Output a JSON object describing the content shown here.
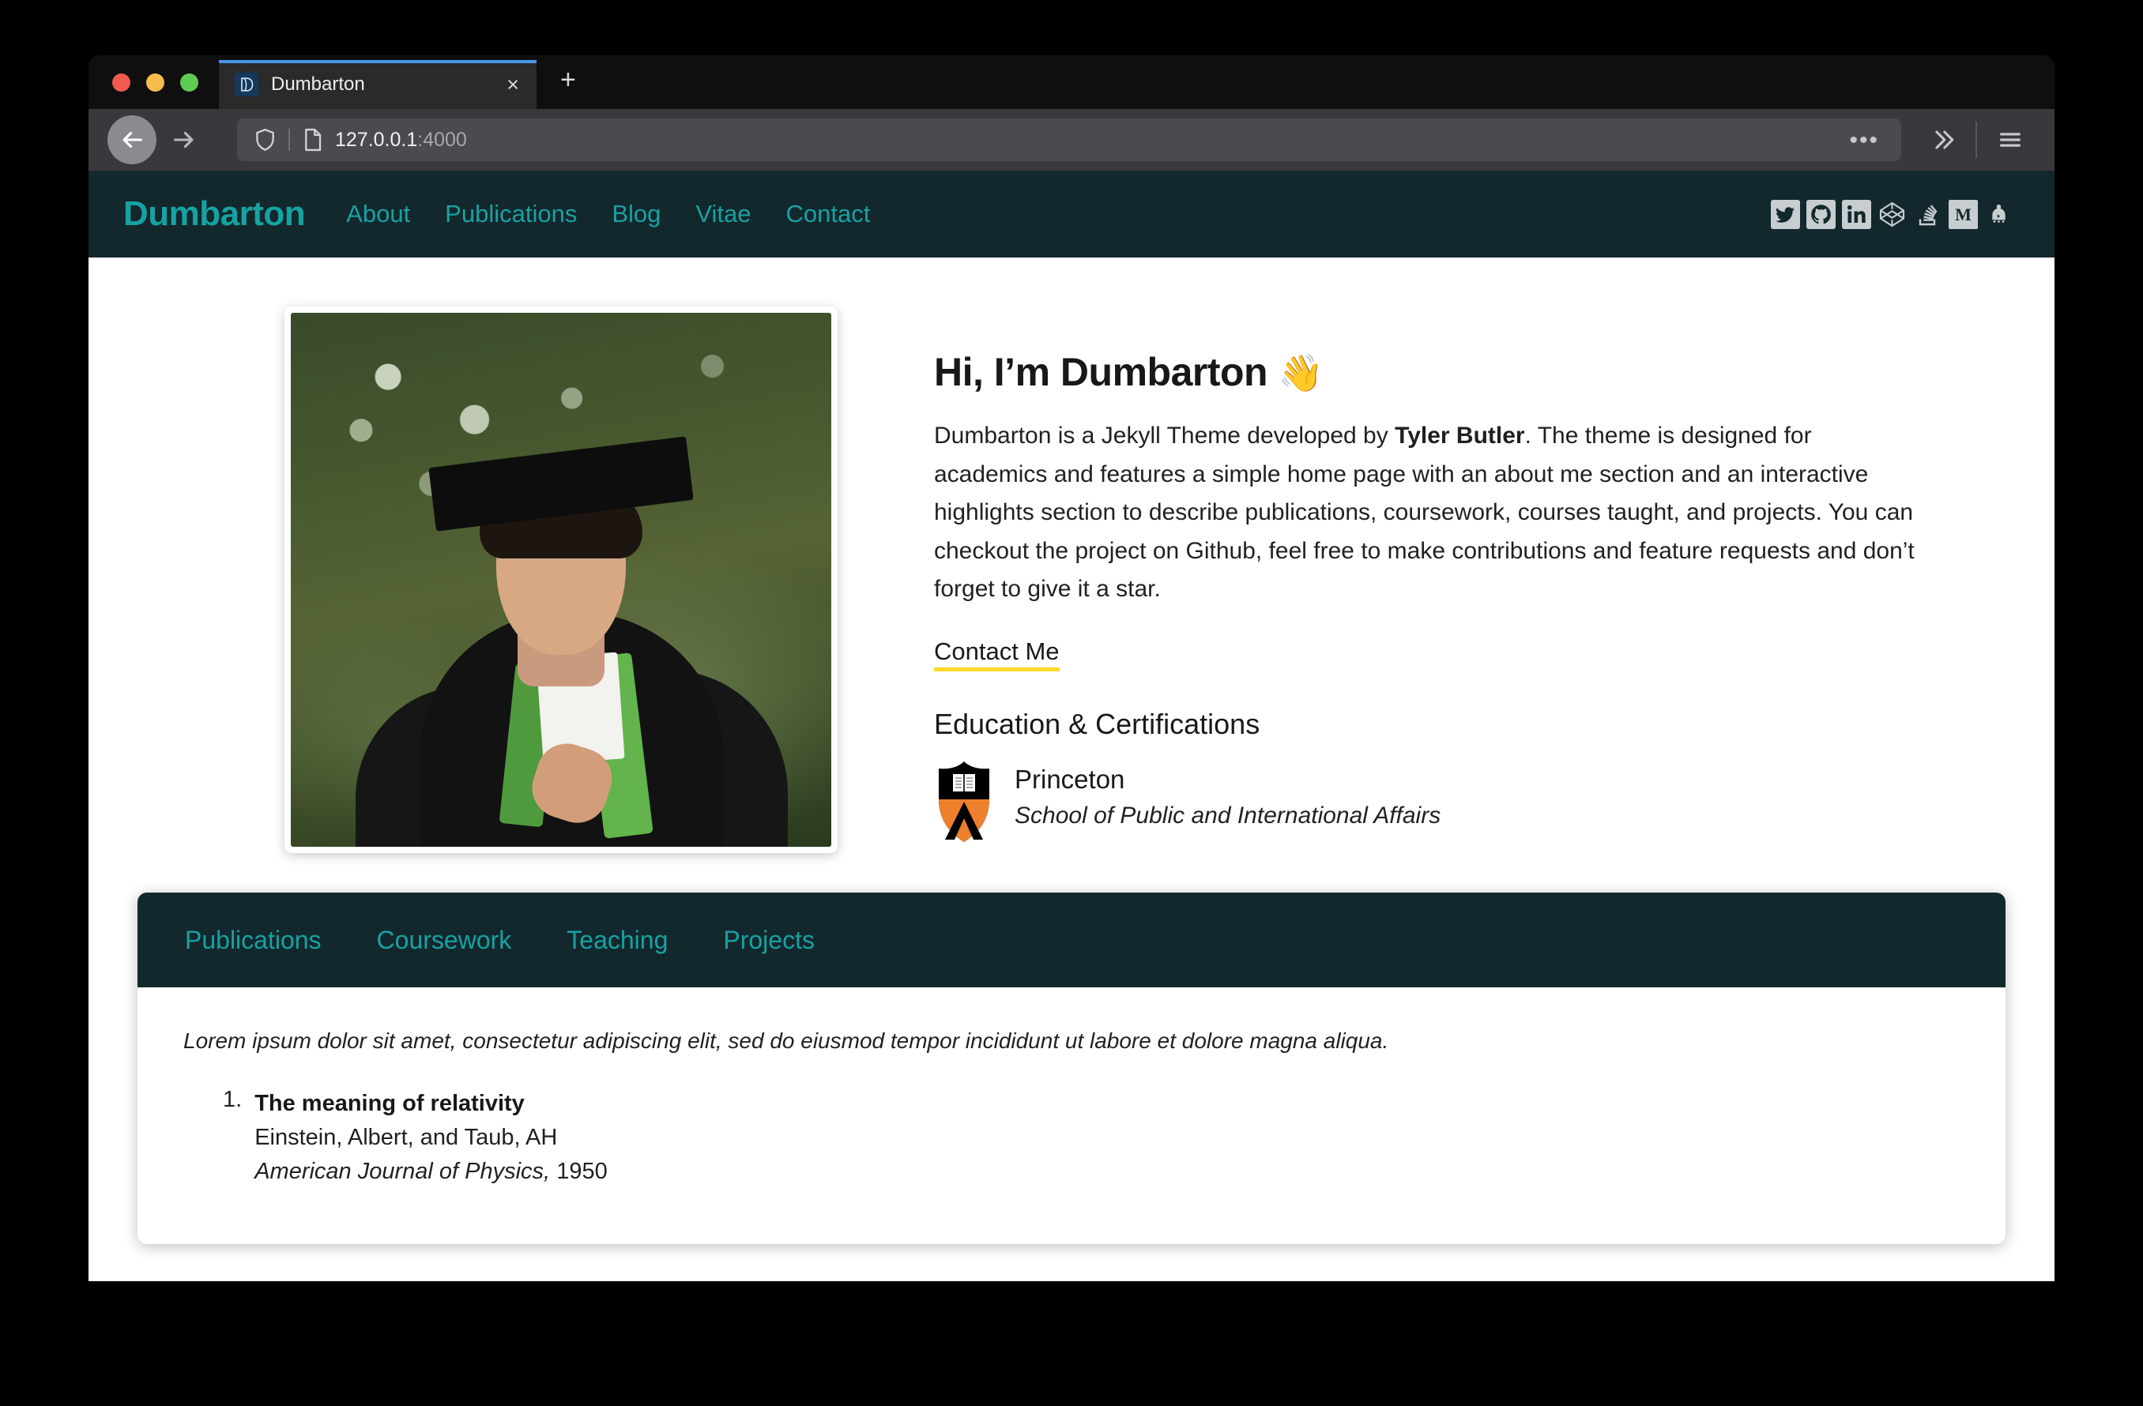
{
  "browser": {
    "tab": {
      "title": "Dumbarton",
      "favicon": "dumbarton-logo-icon",
      "close_label": "×"
    },
    "new_tab_label": "+",
    "url": {
      "host": "127.0.0.1",
      "port": ":4000"
    },
    "icons": {
      "back": "back-arrow-icon",
      "forward": "forward-arrow-icon",
      "shield": "tracking-protection-shield-icon",
      "page": "page-info-icon",
      "overflow": "•••",
      "chevrons": "»",
      "menu": "hamburger-menu-icon"
    }
  },
  "site": {
    "brand": "Dumbarton",
    "nav": [
      {
        "label": "About"
      },
      {
        "label": "Publications"
      },
      {
        "label": "Blog"
      },
      {
        "label": "Vitae"
      },
      {
        "label": "Contact"
      }
    ],
    "social": [
      {
        "name": "twitter"
      },
      {
        "name": "github"
      },
      {
        "name": "linkedin"
      },
      {
        "name": "codepen"
      },
      {
        "name": "stackoverflow"
      },
      {
        "name": "medium"
      },
      {
        "name": "devto"
      }
    ]
  },
  "hero": {
    "photo_alt": "graduate-portrait",
    "title": "Hi, I’m Dumbarton",
    "wave_emoji": "👋",
    "body_parts": {
      "p1": "Dumbarton is a Jekyll Theme developed by ",
      "author": "Tyler Butler",
      "p2": ". The theme is designed for academics and features a simple home page with an about me section and an interactive highlights section to describe publications, coursework, courses taught, and projects. You can checkout the project on ",
      "github": "Github",
      "p3": ", feel free to make contributions and feature requests and don’t forget to give it a star."
    },
    "contact_link": "Contact Me",
    "education_heading": "Education & Certifications",
    "education": [
      {
        "logo": "princeton-shield-icon",
        "school": "Princeton",
        "department": "School of Public and International Affairs"
      }
    ]
  },
  "highlights": {
    "tabs": [
      {
        "label": "Publications",
        "active": true
      },
      {
        "label": "Coursework",
        "active": false
      },
      {
        "label": "Teaching",
        "active": false
      },
      {
        "label": "Projects",
        "active": false
      }
    ],
    "intro": "Lorem ipsum dolor sit amet, consectetur adipiscing elit, sed do eiusmod tempor incididunt ut labore et dolore magna aliqua.",
    "publications": [
      {
        "number": "1.",
        "title": "The meaning of relativity",
        "authors": "Einstein, Albert, and Taub, AH",
        "journal": "American Journal of Physics,",
        "year": "1950"
      }
    ]
  },
  "colors": {
    "header_bg": "#12282d",
    "accent_teal": "#17a2a2",
    "underline_yellow": "#ffd92a",
    "princeton_orange": "#ee7f2d"
  }
}
